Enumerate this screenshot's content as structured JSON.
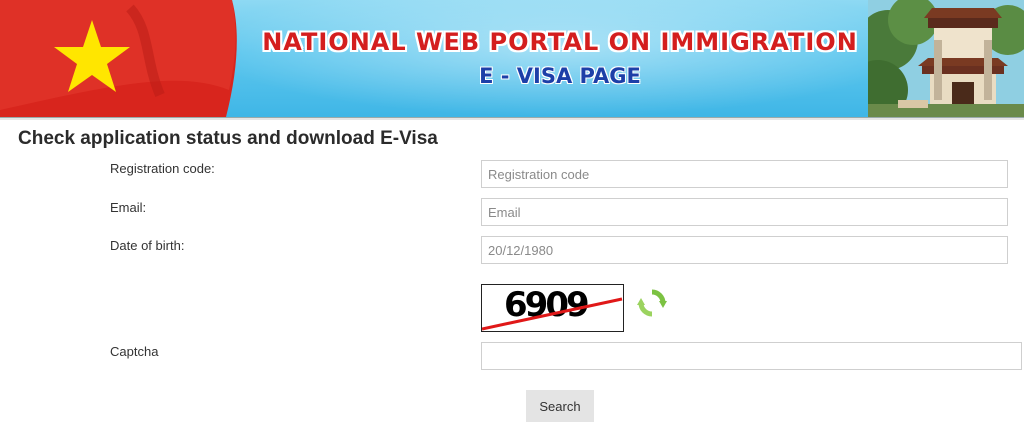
{
  "header": {
    "title": "NATIONAL WEB PORTAL ON IMMIGRATION",
    "subtitle": "E - VISA PAGE"
  },
  "page": {
    "title": "Check application status and download E-Visa"
  },
  "form": {
    "registration_code": {
      "label": "Registration code:",
      "placeholder": "Registration code",
      "value": ""
    },
    "email": {
      "label": "Email:",
      "placeholder": "Email",
      "value": ""
    },
    "date_of_birth": {
      "label": "Date of birth:",
      "placeholder": "20/12/1980",
      "value": ""
    },
    "captcha": {
      "label": "Captcha",
      "image_text": "6909",
      "value": ""
    },
    "search_label": "Search"
  },
  "colors": {
    "title_red": "#d41e1e",
    "subtitle_blue": "#1d3fa8",
    "banner_sky": "#5ec7ee",
    "flag_red": "#d8251d",
    "flag_star": "#ffe600",
    "refresh_green": "#7cc242"
  },
  "icons": {
    "refresh": "refresh-icon"
  }
}
